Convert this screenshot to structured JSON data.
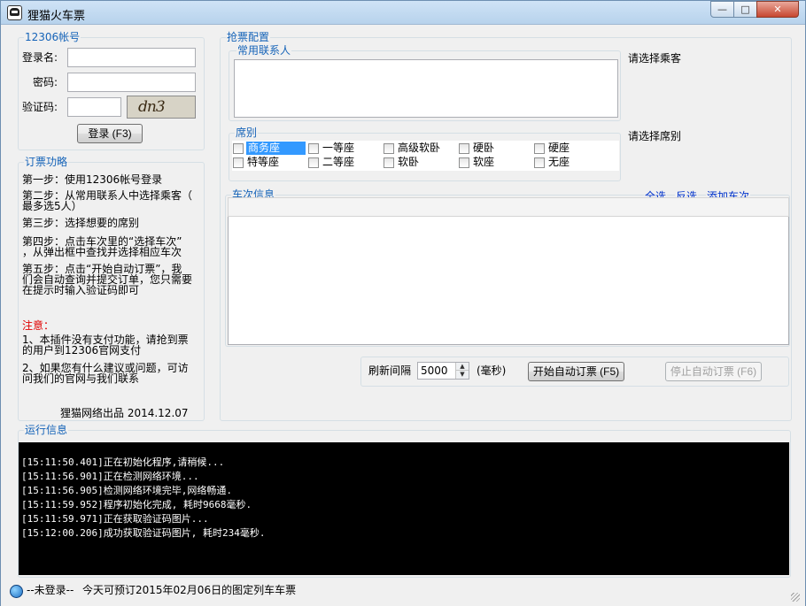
{
  "window": {
    "title": "狸猫火车票",
    "min_label": "—",
    "max_label": "□",
    "close_label": "✕"
  },
  "account": {
    "legend": "12306帐号",
    "username_label": "登录名:",
    "username_value": "",
    "password_label": "密码:",
    "password_value": "",
    "captcha_label": "验证码:",
    "captcha_value": "",
    "captcha_image_text": "dn3",
    "login_button": "登录 (F3)"
  },
  "guide": {
    "legend": "订票功略",
    "step1": "第一步：使用12306帐号登录",
    "step2a": "第二步：从常用联系人中选择乘客（",
    "step2b": "最多选5人）",
    "step3": "第三步：选择想要的席别",
    "step4a": "第四步：点击车次里的“选择车次”",
    "step4b": "，从弹出框中查找并选择相应车次",
    "step5a": "第五步：点击“开始自动订票”，我",
    "step5b": "们会自动查询并提交订单，您只需要",
    "step5c": "在提示时输入验证码即可",
    "notice_title": "注意：",
    "note1a": "1、本插件没有支付功能，请抢到票",
    "note1b": "的用户到12306官网支付",
    "note2a": "2、如果您有什么建议或问题，可访",
    "note2b": "问我们的官网与我们联系",
    "credit": "狸猫网络出品  2014.12.07"
  },
  "config": {
    "legend": "抢票配置",
    "contacts_legend": "常用联系人",
    "select_passenger_hint": "请选择乘客",
    "seat_legend": "席别",
    "select_seat_hint": "请选择席别",
    "seats": [
      {
        "label": "商务座",
        "checked": false,
        "selected": true
      },
      {
        "label": "一等座",
        "checked": false
      },
      {
        "label": "高级软卧",
        "checked": false
      },
      {
        "label": "硬卧",
        "checked": false
      },
      {
        "label": "硬座",
        "checked": false
      },
      {
        "label": "特等座",
        "checked": false
      },
      {
        "label": "二等座",
        "checked": false
      },
      {
        "label": "软卧",
        "checked": false
      },
      {
        "label": "软座",
        "checked": false
      },
      {
        "label": "无座",
        "checked": false
      }
    ],
    "train_legend": "车次信息",
    "select_all": "全选",
    "invert_select": "反选",
    "add_train": "添加车次",
    "refresh_label": "刷新间隔",
    "refresh_value": "5000",
    "refresh_unit": "(毫秒)",
    "start_button": "开始自动订票 (F5)",
    "stop_button": "停止自动订票 (F6)"
  },
  "runlog": {
    "legend": "运行信息",
    "lines": [
      "[15:11:50.401]正在初始化程序,请稍候...",
      "[15:11:56.901]正在检测网络环境...",
      "[15:11:56.905]检测网络环境完毕,网络畅通.",
      "[15:11:59.952]程序初始化完成, 耗时9668毫秒.",
      "[15:11:59.971]正在获取验证码图片...",
      "[15:12:00.206]成功获取验证码图片, 耗时234毫秒."
    ]
  },
  "status": {
    "login_state": "--未登录--",
    "message": "今天可预订2015年02月06日的图定列车车票"
  }
}
